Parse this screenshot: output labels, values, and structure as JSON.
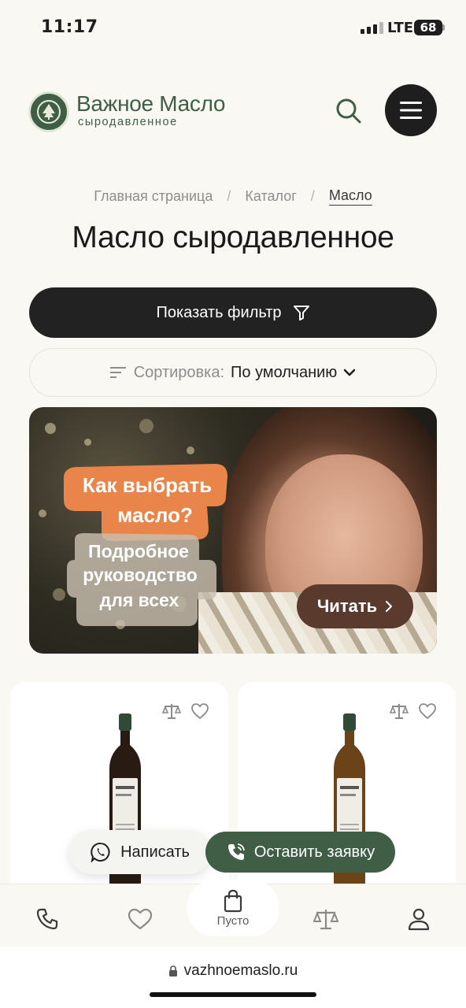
{
  "status": {
    "time": "11:17",
    "network": "LTE",
    "battery": "68"
  },
  "header": {
    "logo_name": "Важное Масло",
    "logo_tagline": "сыродавленное",
    "icons": {
      "search": "search-icon",
      "menu": "hamburger-menu-icon"
    }
  },
  "breadcrumb": {
    "items": [
      "Главная страница",
      "Каталог",
      "Масло"
    ],
    "separator": "/"
  },
  "page_title": "Масло сыродавленное",
  "filter": {
    "label": "Показать фильтр",
    "icon": "filter-icon"
  },
  "sort": {
    "label": "Сортировка:",
    "value": "По умолчанию",
    "icon": "sort-lines-icon"
  },
  "banner": {
    "headline_line1": "Как выбрать",
    "headline_line2": "масло?",
    "sub_line1": "Подробное",
    "sub_line2": "руководство",
    "sub_line3": "для всех",
    "cta": "Читать"
  },
  "products": [
    {
      "bottle_color": "#2a1a14",
      "icons": [
        "compare-scales-icon",
        "heart-icon"
      ]
    },
    {
      "bottle_color": "#6b4318",
      "icons": [
        "compare-scales-icon",
        "heart-icon"
      ]
    }
  ],
  "contact": {
    "write_label": "Написать",
    "request_label": "Оставить заявку"
  },
  "bottom_nav": {
    "items": [
      "phone-icon",
      "heart-icon",
      "cart-icon",
      "compare-scales-icon",
      "user-icon"
    ],
    "cart_label": "Пусто"
  },
  "browser": {
    "url": "vazhnoemaslo.ru"
  },
  "colors": {
    "brand_green": "#3f5e45",
    "dark": "#222222",
    "banner_orange": "#e9854a",
    "cta_brown": "#5a3a2c"
  }
}
